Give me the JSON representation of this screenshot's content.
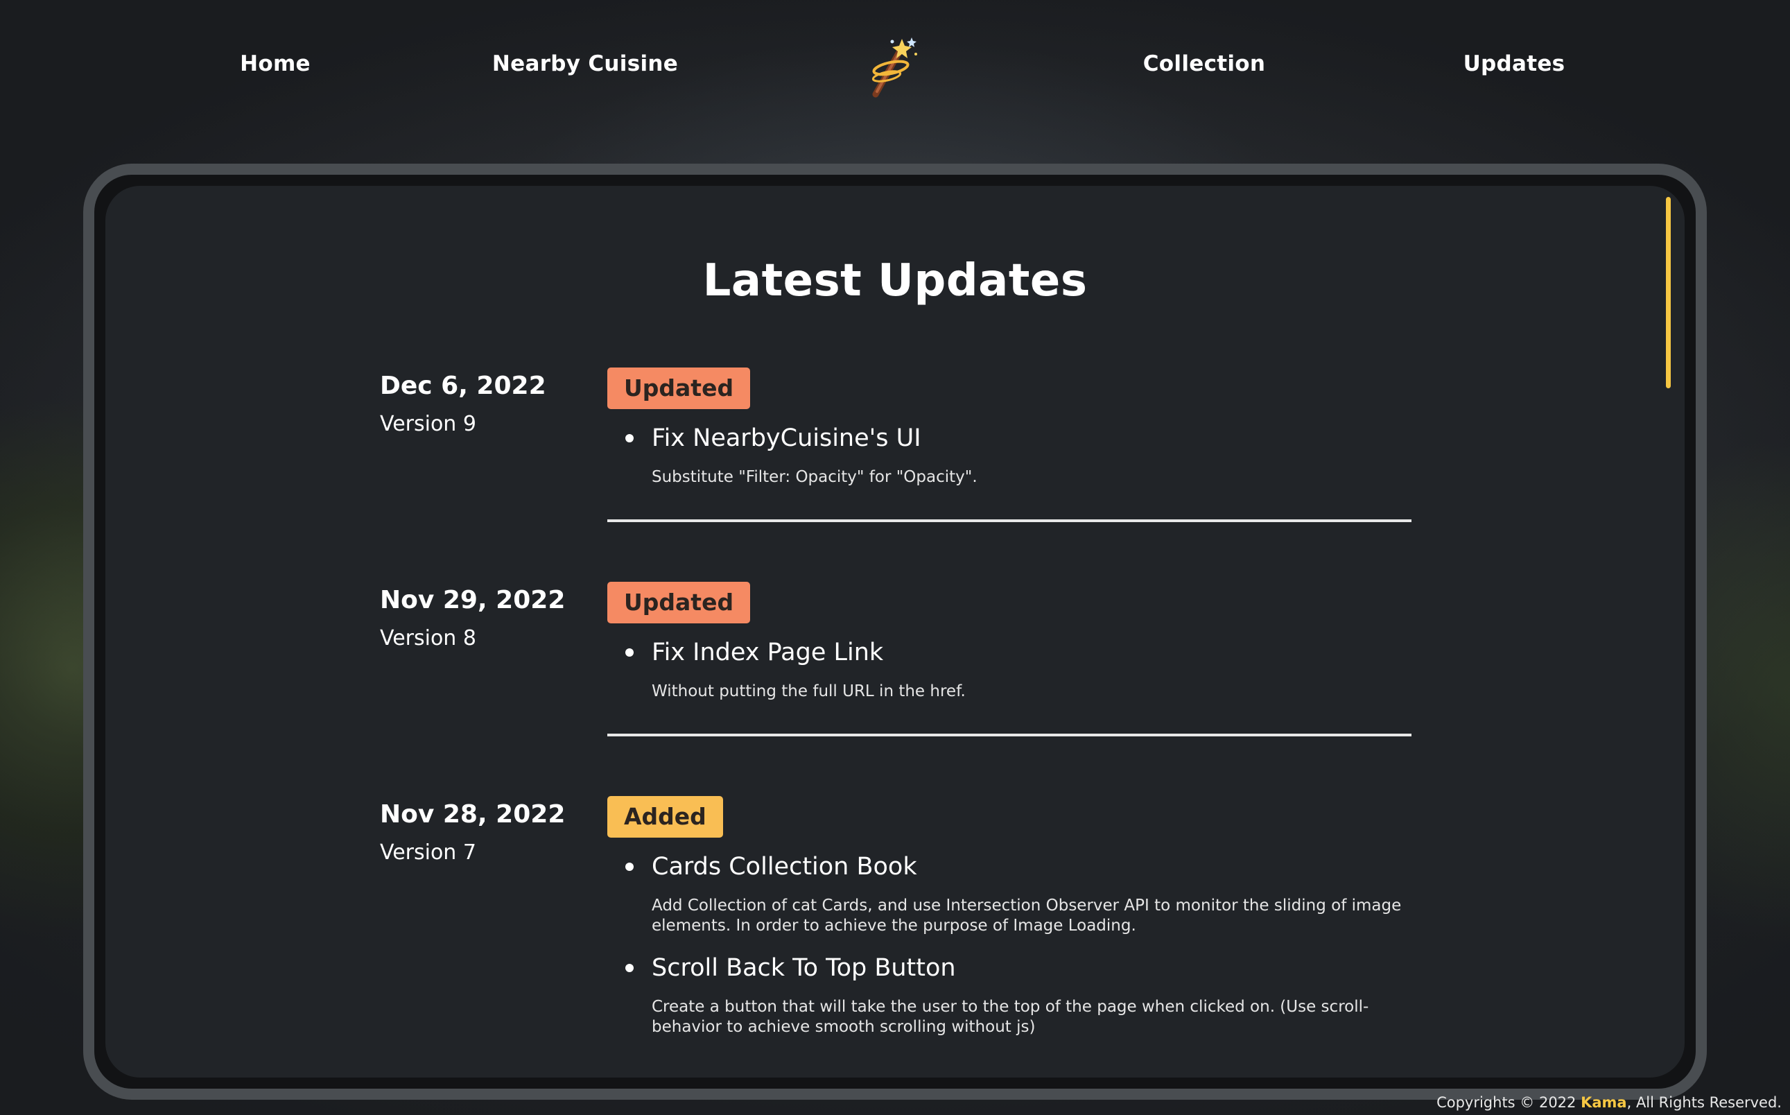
{
  "nav": {
    "home_label": "Home",
    "nearby_label": "Nearby Cuisine",
    "collection_label": "Collection",
    "updates_label": "Updates",
    "logo_icon": "magic-wand-icon"
  },
  "page": {
    "title": "Latest Updates"
  },
  "entries": [
    {
      "date": "Dec 6, 2022",
      "version": "Version 9",
      "badge": "Updated",
      "items": [
        {
          "title": "Fix NearbyCuisine's UI",
          "description": "Substitute \"Filter: Opacity\" for \"Opacity\"."
        }
      ]
    },
    {
      "date": "Nov 29, 2022",
      "version": "Version 8",
      "badge": "Updated",
      "items": [
        {
          "title": "Fix Index Page Link",
          "description": "Without putting the full URL in the href."
        }
      ]
    },
    {
      "date": "Nov 28, 2022",
      "version": "Version 7",
      "badge": "Added",
      "items": [
        {
          "title": "Cards Collection Book",
          "description": "Add Collection of cat Cards, and use Intersection Observer API to monitor the sliding of image elements. In order to achieve the purpose of Image Loading."
        },
        {
          "title": "Scroll Back To Top Button",
          "description": "Create a button that will take the user to the top of the page when clicked on. (Use scroll-behavior to achieve smooth scrolling without js)"
        }
      ]
    }
  ],
  "footer": {
    "prefix": "Copyrights © 2022 ",
    "brand": "Kama",
    "suffix": ", All Rights Reserved."
  },
  "colors": {
    "badge_updated": "#f58a63",
    "badge_added": "#f9be54",
    "accent": "#f6c743",
    "panel": "#212428"
  }
}
